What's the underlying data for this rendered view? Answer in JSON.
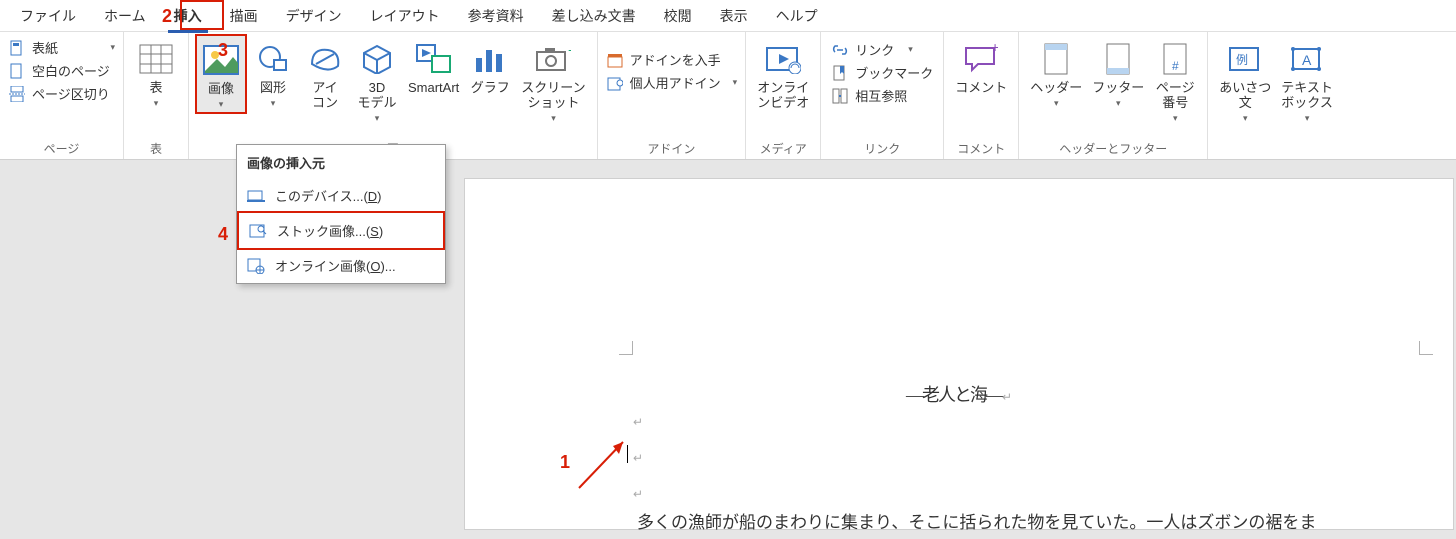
{
  "tabs": {
    "file": "ファイル",
    "home": "ホーム",
    "insert": "挿入",
    "draw": "描画",
    "design": "デザイン",
    "layout": "レイアウト",
    "references": "参考資料",
    "mailings": "差し込み文書",
    "review": "校閲",
    "view": "表示",
    "help": "ヘルプ"
  },
  "groups": {
    "pages": {
      "label": "ページ",
      "cover": "表紙",
      "blank": "空白のページ",
      "break": "ページ区切り"
    },
    "tables": {
      "label": "表",
      "table": "表"
    },
    "illustrations": {
      "label": "図",
      "pictures": "画像",
      "shapes": "図形",
      "icons": "アイ\nコン",
      "models3d": "3D\nモデル",
      "smartart": "SmartArt",
      "chart": "グラフ",
      "screenshot": "スクリーン\nショット"
    },
    "addins": {
      "label": "アドイン",
      "get": "アドインを入手",
      "my": "個人用アドイン"
    },
    "media": {
      "label": "メディア",
      "video": "オンライ\nンビデオ"
    },
    "links": {
      "label": "リンク",
      "link": "リンク",
      "bookmark": "ブックマーク",
      "crossref": "相互参照"
    },
    "comments": {
      "label": "コメント",
      "comment": "コメント"
    },
    "headerfooter": {
      "label": "ヘッダーとフッター",
      "header": "ヘッダー",
      "footer": "フッター",
      "pagenum": "ページ\n番号"
    },
    "text": {
      "greeting": "あいさつ\n文",
      "textbox": "テキスト\nボックス"
    }
  },
  "dropdown": {
    "title": "画像の挿入元",
    "device_prefix": "このデバイス...(",
    "device_key": "D",
    "device_suffix": ")",
    "stock_prefix": "ストック画像...(",
    "stock_key": "S",
    "stock_suffix": ")",
    "online_prefix": "オンライン画像(",
    "online_key": "O",
    "online_suffix": ")..."
  },
  "document": {
    "title": "―老人と海―",
    "body": "多くの漁師が船のまわりに集まり、そこに括られた物を見ていた。一人はズボンの裾をま"
  },
  "annotations": {
    "n1": "1",
    "n2": "2",
    "n3": "3",
    "n4": "4"
  }
}
